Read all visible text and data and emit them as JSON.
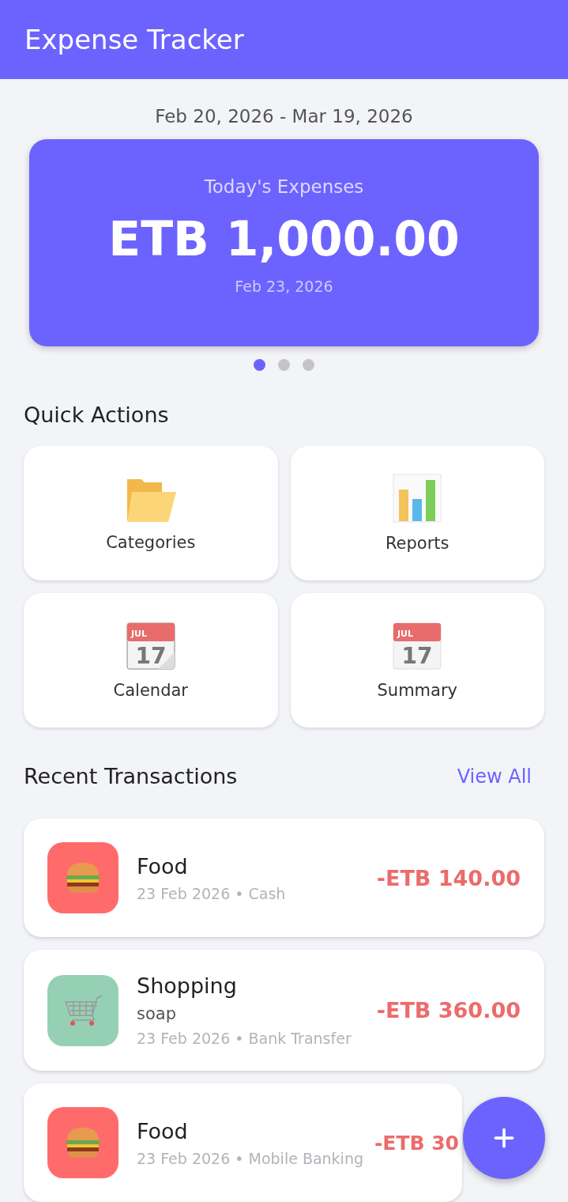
{
  "app_bar": {
    "title": "Expense Tracker"
  },
  "period": "Feb 20, 2026 - Mar 19, 2026",
  "summary_card": {
    "label": "Today's Expenses",
    "amount": "ETB 1,000.00",
    "date": "Feb 23, 2026"
  },
  "carousel_dots": [
    {
      "selected": true
    },
    {
      "selected": false
    },
    {
      "selected": false
    }
  ],
  "quick_actions": {
    "title": "Quick Actions",
    "items": [
      {
        "kind": "folder",
        "label": "Categories"
      },
      {
        "kind": "chart",
        "label": "Reports"
      },
      {
        "kind": "calendar",
        "label": "Calendar",
        "icon_month": "JUL",
        "icon_day": "17"
      },
      {
        "kind": "calendar_flat",
        "label": "Summary",
        "icon_month": "JUL",
        "icon_day": "17"
      }
    ]
  },
  "recent": {
    "title": "Recent Transactions",
    "view_all": "View All",
    "items": [
      {
        "kind": "food",
        "color": "#ff6b6b",
        "category": "Food",
        "meta": "23 Feb 2026 • Cash",
        "amount": "-ETB 140.00"
      },
      {
        "kind": "shopping",
        "color": "#96d0b4",
        "category": "Shopping",
        "note": "soap",
        "meta": "23 Feb 2026 • Bank Transfer",
        "amount": "-ETB 360.00"
      },
      {
        "kind": "food",
        "color": "#ff6b6b",
        "category": "Food",
        "meta": "23 Feb 2026 • Mobile Banking",
        "amount": "-ETB 30"
      }
    ]
  },
  "fab": {
    "kind": "add"
  }
}
